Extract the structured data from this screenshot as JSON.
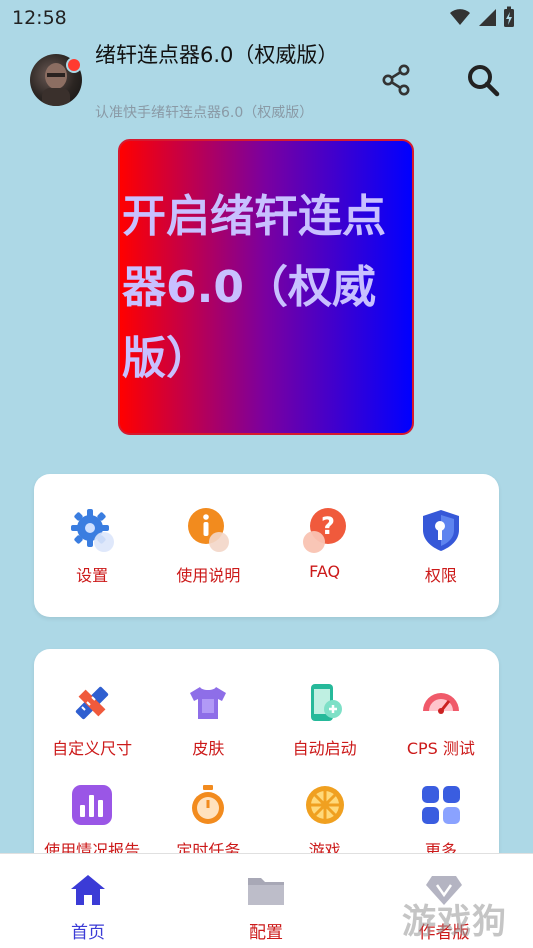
{
  "status_bar": {
    "time": "12:58"
  },
  "header": {
    "title": "绪轩连点器6.0（权威版）",
    "subtitle": "认准快手绪轩连点器6.0（权威版）"
  },
  "start_button": {
    "label": "开启绪轩连点器6.0（权威版）"
  },
  "quick_actions": [
    {
      "label": "设置",
      "icon": "gear-icon"
    },
    {
      "label": "使用说明",
      "icon": "info-icon"
    },
    {
      "label": "FAQ",
      "icon": "question-icon"
    },
    {
      "label": "权限",
      "icon": "shield-key-icon"
    }
  ],
  "features": [
    {
      "label": "自定义尺寸",
      "icon": "ruler-pencil-icon"
    },
    {
      "label": "皮肤",
      "icon": "tshirt-icon"
    },
    {
      "label": "自动启动",
      "icon": "phone-link-icon"
    },
    {
      "label": "CPS 测试",
      "icon": "speedometer-icon"
    },
    {
      "label": "使用情况报告",
      "icon": "bar-chart-icon"
    },
    {
      "label": "定时任务",
      "icon": "stopwatch-icon"
    },
    {
      "label": "游戏",
      "icon": "wheel-icon"
    },
    {
      "label": "更多",
      "icon": "grid-icon"
    }
  ],
  "bottom_nav": [
    {
      "label": "首页",
      "icon": "home-icon",
      "active": true
    },
    {
      "label": "配置",
      "icon": "folder-icon",
      "active": false
    },
    {
      "label": "作者版",
      "icon": "gem-icon",
      "active": false
    }
  ],
  "watermark": "游戏狗",
  "colors": {
    "background": "#add8e6",
    "label_red": "#cc1a1a",
    "nav_active": "#3b3bd6",
    "nav_inactive": "#cc1a1a"
  }
}
